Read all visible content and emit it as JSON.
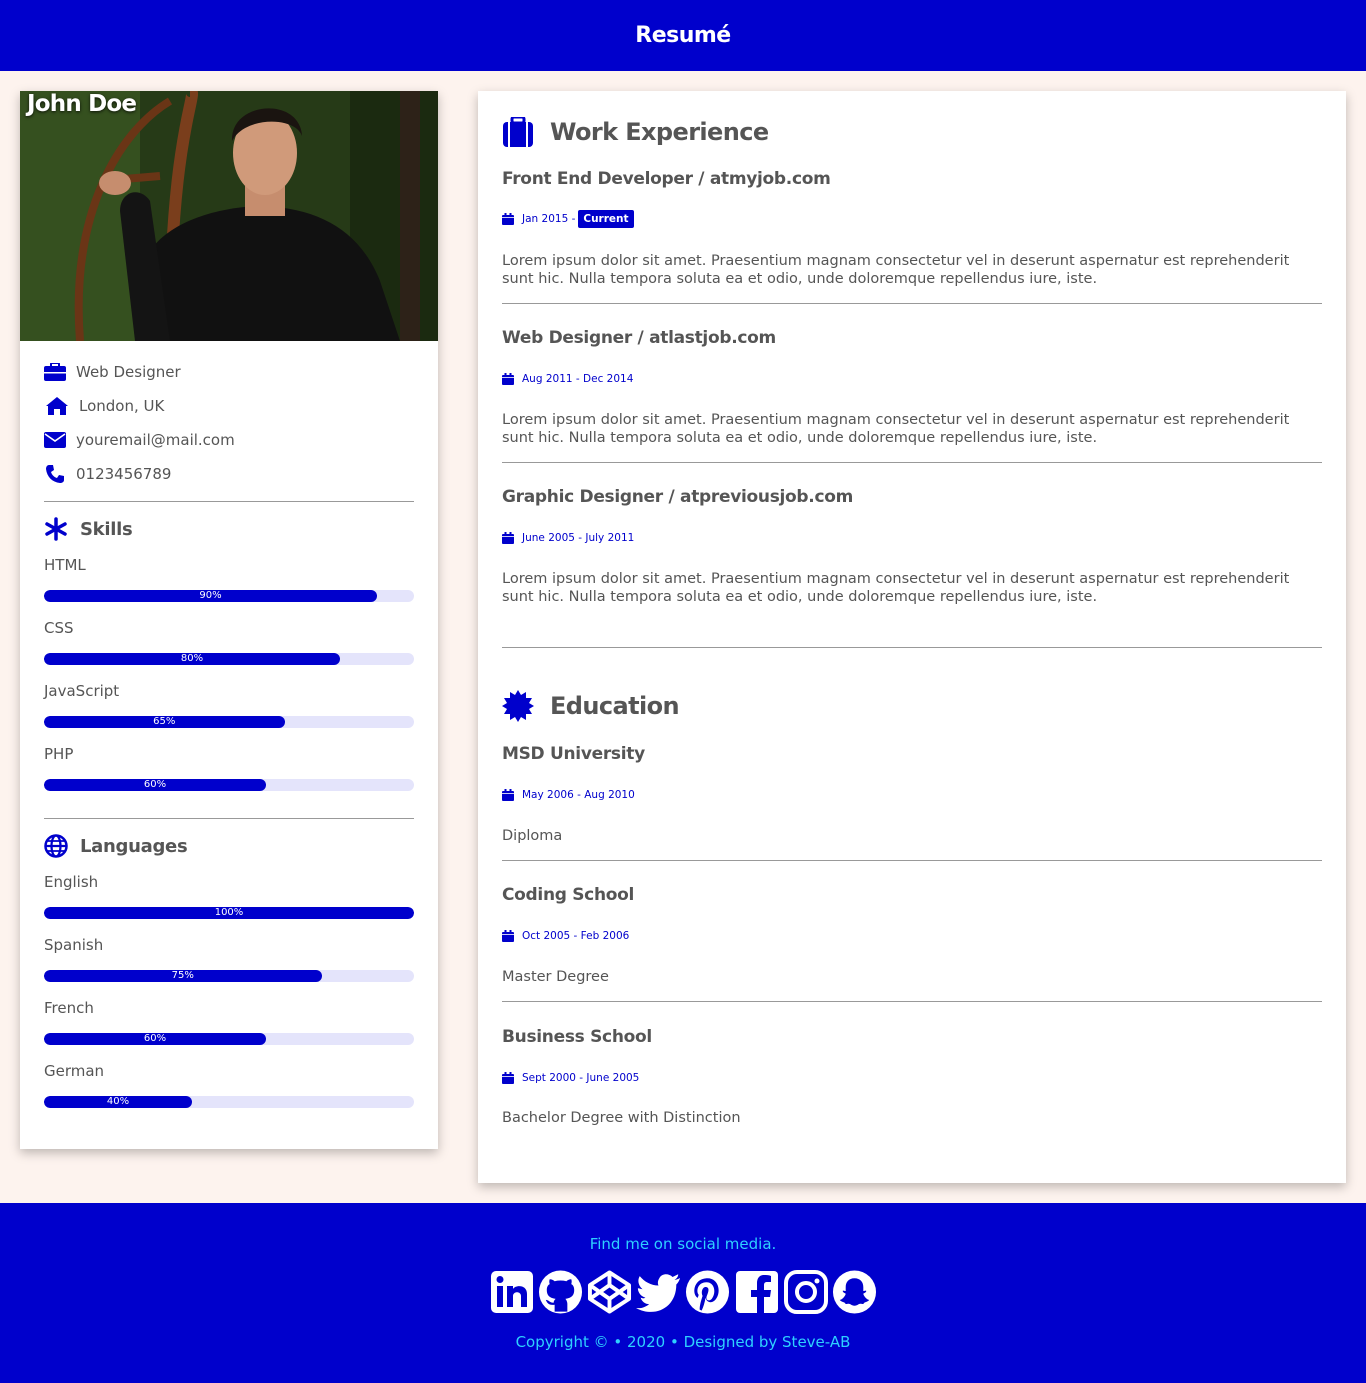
{
  "header": {
    "title": "Resumé"
  },
  "profile": {
    "name": "John Doe",
    "photo_icon": "portrait-photo",
    "info": [
      {
        "icon": "briefcase-icon",
        "text": "Web Designer"
      },
      {
        "icon": "home-icon",
        "text": "London, UK"
      },
      {
        "icon": "envelope-icon",
        "text": "youremail@mail.com"
      },
      {
        "icon": "phone-icon",
        "text": "0123456789"
      }
    ]
  },
  "skills": {
    "title": "Skills",
    "items": [
      {
        "label": "HTML",
        "percent": 90,
        "text": "90%"
      },
      {
        "label": "CSS",
        "percent": 80,
        "text": "80%"
      },
      {
        "label": "JavaScript",
        "percent": 65,
        "text": "65%"
      },
      {
        "label": "PHP",
        "percent": 60,
        "text": "60%"
      }
    ]
  },
  "languages": {
    "title": "Languages",
    "items": [
      {
        "label": "English",
        "percent": 100,
        "text": "100%"
      },
      {
        "label": "Spanish",
        "percent": 75,
        "text": "75%"
      },
      {
        "label": "French",
        "percent": 60,
        "text": "60%"
      },
      {
        "label": "German",
        "percent": 40,
        "text": "40%"
      }
    ]
  },
  "work": {
    "title": "Work Experience",
    "entries": [
      {
        "title": "Front End Developer / atmyjob.com",
        "date": "Jan 2015 -",
        "badge": "Current",
        "desc": "Lorem ipsum dolor sit amet. Praesentium magnam consectetur vel in deserunt aspernatur est reprehenderit sunt hic. Nulla tempora soluta ea et odio, unde doloremque repellendus iure, iste."
      },
      {
        "title": "Web Designer / atlastjob.com",
        "date": "Aug 2011 - Dec 2014",
        "desc": "Lorem ipsum dolor sit amet. Praesentium magnam consectetur vel in deserunt aspernatur est reprehenderit sunt hic. Nulla tempora soluta ea et odio, unde doloremque repellendus iure, iste."
      },
      {
        "title": "Graphic Designer / atpreviousjob.com",
        "date": "June 2005 - July 2011",
        "desc": "Lorem ipsum dolor sit amet. Praesentium magnam consectetur vel in deserunt aspernatur est reprehenderit sunt hic. Nulla tempora soluta ea et odio, unde doloremque repellendus iure, iste."
      }
    ]
  },
  "education": {
    "title": "Education",
    "entries": [
      {
        "title": "MSD University",
        "date": "May 2006 - Aug 2010",
        "desc": "Diploma"
      },
      {
        "title": "Coding School",
        "date": "Oct 2005 - Feb 2006",
        "desc": "Master Degree"
      },
      {
        "title": "Business School",
        "date": "Sept 2000 - June 2005",
        "desc": "Bachelor Degree with Distinction"
      }
    ]
  },
  "footer": {
    "find": "Find me on social media.",
    "socials": [
      "linkedin-icon",
      "github-icon",
      "codepen-icon",
      "twitter-icon",
      "pinterest-icon",
      "facebook-icon",
      "instagram-icon",
      "snapchat-icon"
    ],
    "copyright": "Copyright © • 2020 • Designed by Steve-AB"
  },
  "colors": {
    "accent": "#0000cc",
    "background": "#fdf3ee",
    "footer_text": "#2ed0ff"
  }
}
